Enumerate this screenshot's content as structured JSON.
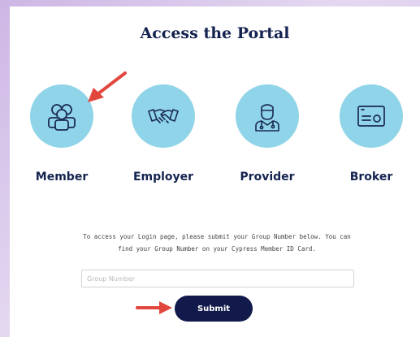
{
  "page": {
    "title": "Access the Portal"
  },
  "roles": [
    {
      "label": "Member",
      "icon": "members-icon"
    },
    {
      "label": "Employer",
      "icon": "handshake-icon"
    },
    {
      "label": "Provider",
      "icon": "doctor-icon"
    },
    {
      "label": "Broker",
      "icon": "id-card-icon"
    }
  ],
  "instructions": {
    "line1": "To access your Login page, please submit your Group Number below. You can",
    "line2": "find your Group Number on your Cypress Member ID Card."
  },
  "form": {
    "group_number_placeholder": "Group Number",
    "group_number_value": "",
    "submit_label": "Submit"
  },
  "colors": {
    "circle": "#8fd4e8",
    "navy": "#14234f",
    "button": "#111a4b",
    "arrow": "#e1473d",
    "background": "#d6c3ea"
  }
}
